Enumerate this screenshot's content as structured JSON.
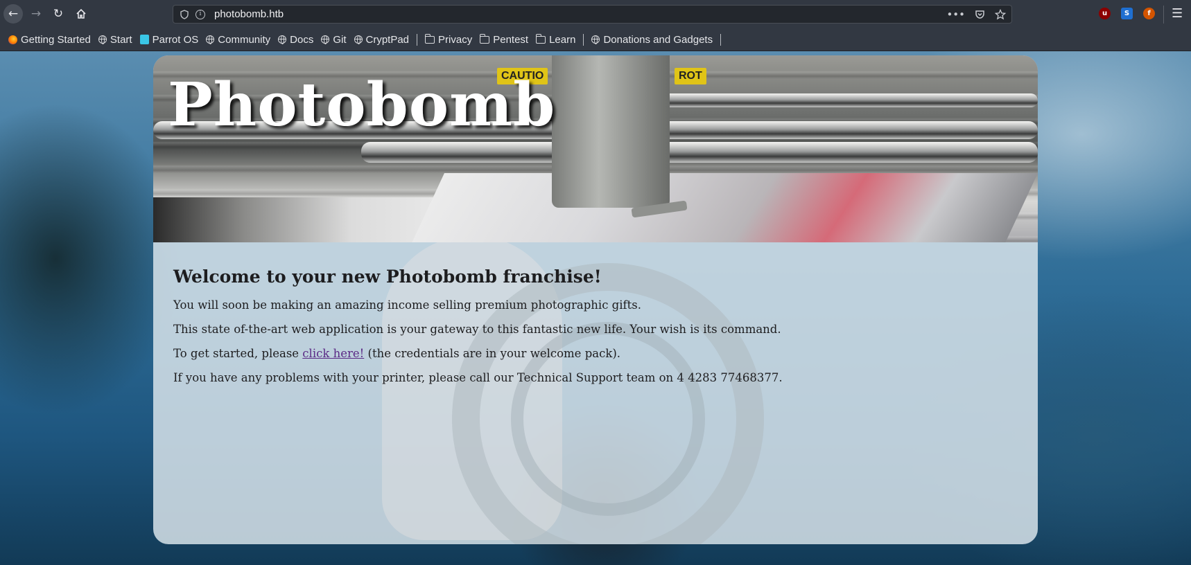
{
  "browser": {
    "url": "photobomb.htb",
    "page_actions": [
      "more-actions",
      "pocket",
      "bookmark-star"
    ],
    "extensions": [
      "ublock-origin",
      "s-extension",
      "foxyproxy"
    ]
  },
  "bookmarks": [
    {
      "label": "Getting Started",
      "icon": "firefox-icon"
    },
    {
      "label": "Start",
      "icon": "globe-icon"
    },
    {
      "label": "Parrot OS",
      "icon": "parrot-icon"
    },
    {
      "label": "Community",
      "icon": "globe-icon"
    },
    {
      "label": "Docs",
      "icon": "globe-icon"
    },
    {
      "label": "Git",
      "icon": "globe-icon"
    },
    {
      "label": "CryptPad",
      "icon": "globe-icon"
    },
    {
      "label": "Privacy",
      "icon": "folder-icon"
    },
    {
      "label": "Pentest",
      "icon": "folder-icon"
    },
    {
      "label": "Learn",
      "icon": "folder-icon"
    },
    {
      "label": "Donations and Gadgets",
      "icon": "globe-icon"
    }
  ],
  "page": {
    "title": "Photobomb",
    "banner_labels": [
      "CAUTIO",
      "ROT"
    ],
    "heading": "Welcome to your new Photobomb franchise!",
    "para1": "You will soon be making an amazing income selling premium photographic gifts.",
    "para2": "This state of-the-art web application is your gateway to this fantastic new life. Your wish is its command.",
    "para3_before": "To get started, please ",
    "para3_link": "click here!",
    "para3_after": " (the credentials are in your welcome pack).",
    "para4": "If you have any problems with your printer, please call our Technical Support team on 4 4283 77468377."
  },
  "colors": {
    "toolbar": "#323842",
    "link": "#5a2a86",
    "card": "#d6e2e9"
  }
}
